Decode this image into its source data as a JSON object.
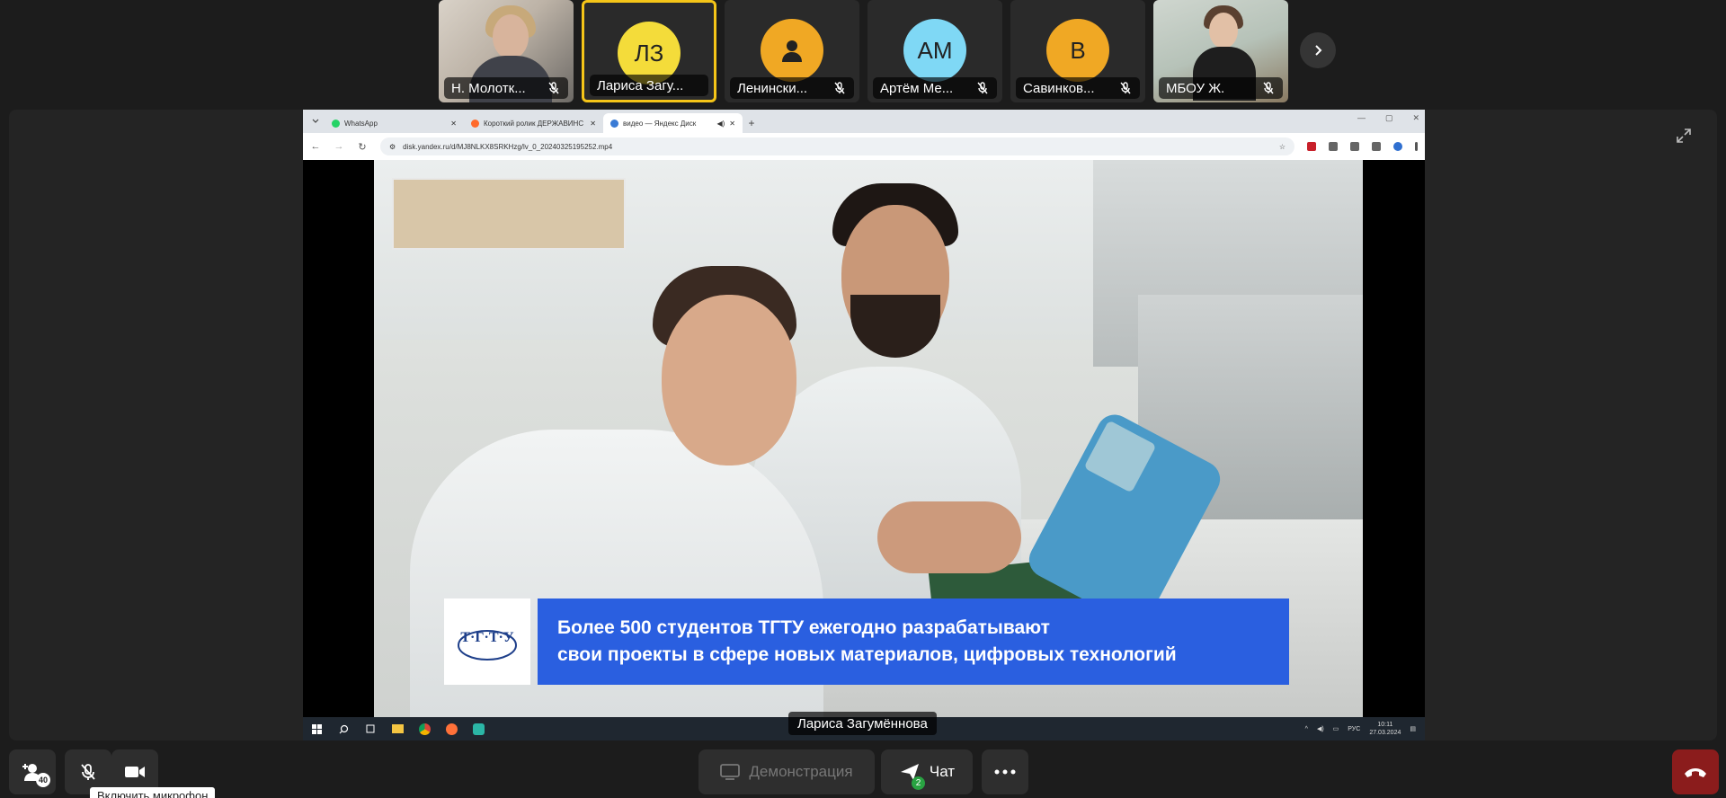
{
  "participants": [
    {
      "name": "Н. Молотк...",
      "type": "photo",
      "muted": true
    },
    {
      "name": "Лариса Загу...",
      "type": "initials",
      "initials": "ЛЗ",
      "color": "#f4dc3a",
      "active": true,
      "muted": false
    },
    {
      "name": "Ленински...",
      "type": "icon",
      "color": "#f0a824",
      "muted": true
    },
    {
      "name": "Артём Ме...",
      "type": "initials",
      "initials": "АМ",
      "color": "#7fd8f5",
      "muted": true
    },
    {
      "name": "Савинков...",
      "type": "initials",
      "initials": "В",
      "color": "#f0a824",
      "muted": true
    },
    {
      "name": "МБОУ Ж.",
      "type": "photo",
      "muted": true
    }
  ],
  "browser": {
    "tabs": [
      "WhatsApp",
      "Короткий ролик ДЕРЖАВИНС",
      "видео — Яндекс Диск"
    ],
    "url": "disk.yandex.ru/d/MJ8NLKX8SRKHzg/lv_0_20240325195252.mp4"
  },
  "video": {
    "logo_text": "Т·Г·Т·У",
    "caption_line1": "Более 500 студентов ТГТУ ежегодно разрабатывают",
    "caption_line2": "свои проекты в сфере новых материалов, цифровых технологий"
  },
  "taskbar": {
    "lang": "РУС",
    "time": "10:11",
    "date": "27.03.2024"
  },
  "speaker_name": "Лариса Загумённова",
  "toolbar": {
    "invite_count": "40",
    "demo_label": "Демонстрация",
    "chat_label": "Чат",
    "chat_badge": "2",
    "tooltip": "Включить микрофон"
  },
  "colors": {
    "accent_active": "#f5c518",
    "hangup": "#8b1c1c",
    "caption_blue": "#2a5fe0"
  }
}
